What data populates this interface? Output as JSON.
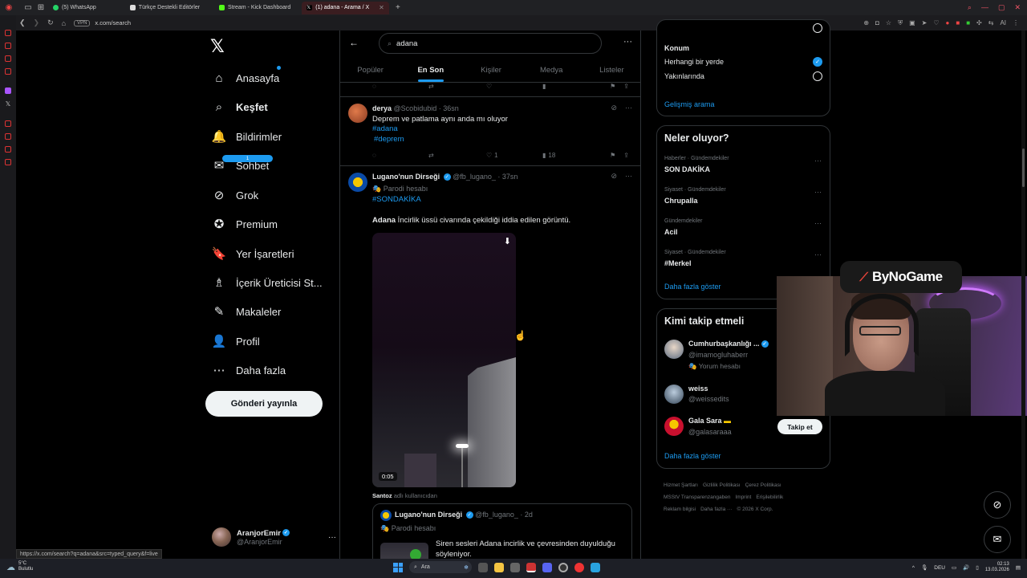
{
  "browser": {
    "tabs": [
      {
        "label": "(5) WhatsApp",
        "color": "#25d366"
      },
      {
        "label": "Türkçe Destekli Editörler",
        "color": "#dddddd"
      },
      {
        "label": "Stream - Kick Dashboard",
        "color": "#53fc18"
      },
      {
        "label": "(1) adana - Arama / X",
        "color": "#ffffff",
        "active": true
      }
    ],
    "new_tab": "+",
    "vpn": "VPN",
    "url": "x.com/search",
    "ai_label": "AI",
    "status_url": "https://x.com/search?q=adana&src=typed_query&f=live"
  },
  "nav": {
    "items": [
      {
        "label": "Anasayfa",
        "icon": "home-icon",
        "glyph": "⌂"
      },
      {
        "label": "Keşfet",
        "icon": "search-icon",
        "glyph": "⌕",
        "bold": true
      },
      {
        "label": "Bildirimler",
        "icon": "bell-icon",
        "glyph": "🔔"
      },
      {
        "label": "Sohbet",
        "icon": "mail-icon",
        "glyph": "✉",
        "badge": "1"
      },
      {
        "label": "Grok",
        "icon": "grok-icon",
        "glyph": "⊘"
      },
      {
        "label": "Premium",
        "icon": "premium-icon",
        "glyph": "✪"
      },
      {
        "label": "Yer İşaretleri",
        "icon": "bookmark-icon",
        "glyph": "🔖"
      },
      {
        "label": "İçerik Üreticisi St...",
        "icon": "creator-icon",
        "glyph": "♗"
      },
      {
        "label": "Makaleler",
        "icon": "article-icon",
        "glyph": "✎"
      },
      {
        "label": "Profil",
        "icon": "profile-icon",
        "glyph": "👤"
      },
      {
        "label": "Daha fazla",
        "icon": "more-icon",
        "glyph": "⋯"
      }
    ],
    "post_button": "Gönderi yayınla",
    "account": {
      "name": "AranjorEmir",
      "handle": "@AranjorEmir"
    }
  },
  "search": {
    "query": "adana",
    "tabs": [
      "Popüler",
      "En Son",
      "Kişiler",
      "Medya",
      "Listeler"
    ],
    "active_tab": 1
  },
  "tweets": [
    {
      "name": "derya",
      "handle": "@Scobidubid",
      "time": "36sn",
      "text": "Deprem ve patlama aynı anda mı oluyor",
      "hashtags": [
        "#adana",
        "#deprem"
      ],
      "likes": "1",
      "views": "18"
    },
    {
      "name": "Lugano'nun Dirseği",
      "handle": "@fb_lugano_",
      "time": "37sn",
      "parody": "Parodi hesabı",
      "hashtag": "#SONDAKİKA",
      "text_bold": "Adana",
      "text": " İncirlik üssü civarında çekildiği iddia edilen görüntü.",
      "video_time": "0:05",
      "source_user": "Santoz",
      "source_suffix": "adlı kullanıcıdan",
      "quote": {
        "name": "Lugano'nun Dirseği",
        "handle": "@fb_lugano_",
        "time": "2d",
        "parody": "Parodi hesabı",
        "text_line1": "Siren sesleri Adana incirlik ve çevresinden duyulduğu",
        "text_line2": "söyleniyor."
      }
    }
  ],
  "filters": {
    "location_label": "Konum",
    "options": [
      "Herhangi bir yerde",
      "Yakınlarında"
    ],
    "selected": 0,
    "advanced": "Gelişmiş arama"
  },
  "trends": {
    "title": "Neler oluyor?",
    "items": [
      {
        "category": "Haberler · Gündemdekiler",
        "name": "SON DAKİKA"
      },
      {
        "category": "Siyaset · Gündemdekiler",
        "name": "Chrupalla"
      },
      {
        "category": "Gündemdekiler",
        "name": "Acil"
      },
      {
        "category": "Siyaset · Gündemdekiler",
        "name": "#Merkel"
      }
    ],
    "show_more": "Daha fazla göster"
  },
  "who_to_follow": {
    "title": "Kimi takip etmeli",
    "users": [
      {
        "name": "Cumhurbaşkanlığı ...",
        "handle": "@imamogluhaberr",
        "sub": "Yorum hesabı"
      },
      {
        "name": "weiss",
        "handle": "@weissedits"
      },
      {
        "name": "Gala Sara",
        "handle": "@galasaraaa",
        "follow": "Takip et"
      }
    ],
    "show_more": "Daha fazla göster"
  },
  "footer": [
    "Hizmet Şartları",
    "Gizlilik Politikası",
    "Çerez Politikası",
    "MSStV Transparenzangaben",
    "Imprint",
    "Erişilebilirlik",
    "Reklam bilgisi",
    "Daha fazla ···",
    "© 2026 X Corp."
  ],
  "overlay": {
    "brand": "ByNoGame"
  },
  "taskbar": {
    "weather_temp": "5°C",
    "weather_desc": "Bulutlu",
    "search": "Ara",
    "lang": "DEU",
    "time": "02:13",
    "date": "13.03.2026"
  }
}
